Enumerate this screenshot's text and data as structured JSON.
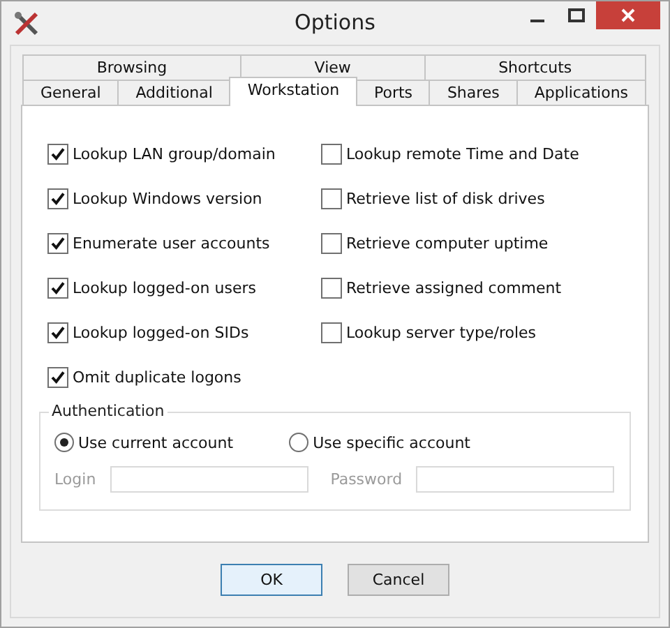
{
  "window": {
    "title": "Options"
  },
  "tab_rows": [
    {
      "tabs": [
        {
          "label": "Browsing",
          "selected": false
        },
        {
          "label": "View",
          "selected": false
        },
        {
          "label": "Shortcuts",
          "selected": false
        }
      ]
    },
    {
      "tabs": [
        {
          "label": "General",
          "selected": false
        },
        {
          "label": "Additional",
          "selected": false
        },
        {
          "label": "Workstation",
          "selected": true
        },
        {
          "label": "Ports",
          "selected": false
        },
        {
          "label": "Shares",
          "selected": false
        },
        {
          "label": "Applications",
          "selected": false
        }
      ]
    }
  ],
  "options_left": [
    {
      "label": "Lookup LAN group/domain",
      "checked": true
    },
    {
      "label": "Lookup Windows version",
      "checked": true
    },
    {
      "label": "Enumerate user accounts",
      "checked": true
    },
    {
      "label": "Lookup logged-on users",
      "checked": true
    },
    {
      "label": "Lookup logged-on SIDs",
      "checked": true
    },
    {
      "label": "Omit duplicate logons",
      "checked": true
    }
  ],
  "options_right": [
    {
      "label": "Lookup remote Time and Date",
      "checked": false
    },
    {
      "label": "Retrieve list of disk drives",
      "checked": false
    },
    {
      "label": "Retrieve computer uptime",
      "checked": false
    },
    {
      "label": "Retrieve assigned comment",
      "checked": false
    },
    {
      "label": "Lookup server type/roles",
      "checked": false
    }
  ],
  "authentication": {
    "title": "Authentication",
    "accounts": [
      {
        "label": "Use current account",
        "selected": true
      },
      {
        "label": "Use specific account",
        "selected": false
      }
    ],
    "fields": [
      {
        "label": "Login",
        "disabled": true
      },
      {
        "label": "Password",
        "disabled": true
      }
    ]
  },
  "buttons": [
    {
      "label": "OK",
      "default": true
    },
    {
      "label": "Cancel",
      "default": false
    }
  ]
}
